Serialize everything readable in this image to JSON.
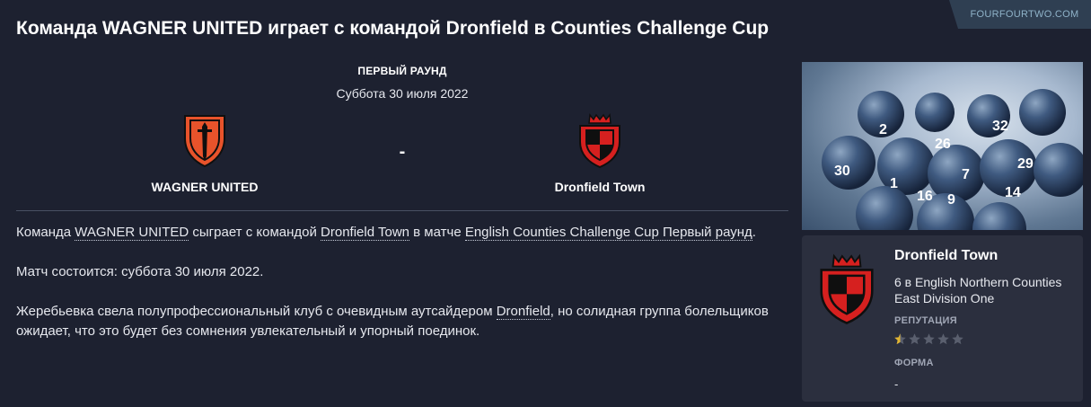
{
  "source": {
    "label": "FOURFOURTWO.COM"
  },
  "headline": "Команда WAGNER UNITED играет с командой Dronfield в Counties Challenge Cup",
  "fixture": {
    "round": "ПЕРВЫЙ РАУНД",
    "date": "Суббота 30 июля 2022",
    "separator": "-",
    "home_team": "WAGNER UNITED",
    "away_team": "Dronfield Town"
  },
  "body": {
    "p1": {
      "t1": "Команда ",
      "home_link": "WAGNER UNITED",
      "t2": " сыграет с командой ",
      "away_link": "Dronfield Town",
      "t3": " в матче ",
      "competition_link": "English Counties Challenge Cup Первый раунд",
      "t4": "."
    },
    "p2": "Матч состоится: суббота 30 июля 2022.",
    "p3": {
      "t1": "Жеребьевка свела полупрофессиональный клуб с очевидным аутсайдером ",
      "team_link": "Dronfield",
      "t2": ", но солидная группа болельщиков ожидает, что это будет без сомнения увлекательный и упорный поединок."
    }
  },
  "sidebar": {
    "image_numbers": [
      "2",
      "26",
      "32",
      "16",
      "30",
      "7",
      "29",
      "14",
      "1",
      "9"
    ],
    "card": {
      "team_name": "Dronfield Town",
      "position": "6 в English Northern Counties East Division One",
      "reputation_label": "РЕПУТАЦИЯ",
      "reputation_stars": 0.5,
      "reputation_max": 5,
      "form_label": "ФОРМА",
      "form_value": "-"
    }
  },
  "colors": {
    "background": "#1d2130",
    "card_background": "#2b2f3e",
    "home_crest": "#e8532b",
    "away_crest": "#d6201f",
    "star_filled": "#e2b531",
    "star_empty": "#5a5f6e"
  },
  "icons": {
    "home_crest": "sword-shield-crest-icon",
    "away_crest": "crown-chequered-shield-crest-icon",
    "star": "star-icon"
  }
}
